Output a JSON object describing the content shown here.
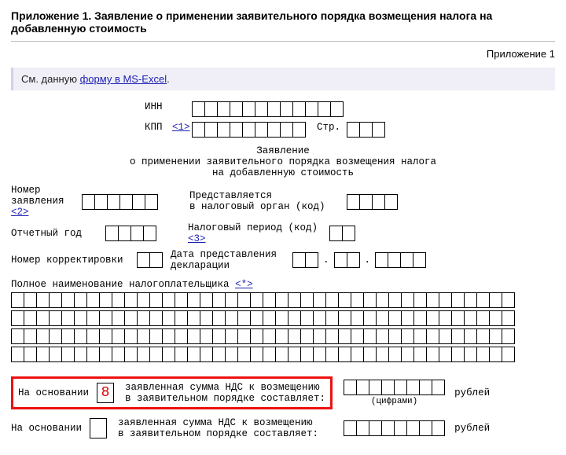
{
  "title_main": "Приложение 1. Заявление о применении заявительного порядка возмещения налога на добавленную стоимость",
  "title_right": "Приложение 1",
  "note": {
    "prefix": "См. данную ",
    "link": "форму в MS-Excel",
    "suffix": "."
  },
  "labels": {
    "inn": "ИНН",
    "kpp": "КПП",
    "kpp_note": "<1>",
    "str": "Стр.",
    "app_title1": "Заявление",
    "app_title2": "о применении заявительного порядка возмещения налога",
    "app_title3": "на добавленную стоимость",
    "num": "Номер",
    "num2": "заявления",
    "num_note": "<2>",
    "presented": "Представляется",
    "presented2": "в налоговый орган (код)",
    "year": "Отчетный год",
    "period": "Налоговый период (код)",
    "period_note": "<3>",
    "corr": "Номер корректировки",
    "decl_date": "Дата представления",
    "decl_date2": "декларации",
    "payer": "Полное наименование налогоплательщика",
    "payer_note": "<*>",
    "basis": "На основании",
    "basis_val": "8",
    "basis_text1": "заявленная сумма НДС к возмещению",
    "basis_text2": "в заявительном порядке составляет:",
    "rub": "рублей",
    "digits": "(цифрами)"
  },
  "date_sep": "."
}
